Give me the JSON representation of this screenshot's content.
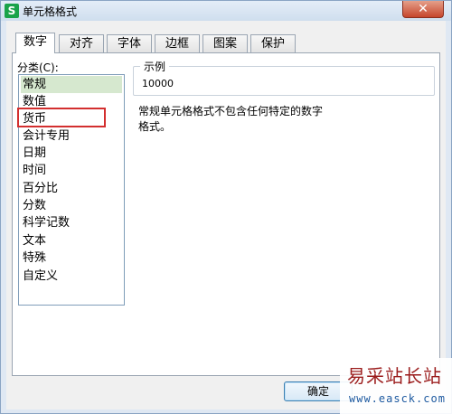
{
  "window": {
    "title": "单元格格式",
    "app_icon_letter": "S",
    "close_glyph": "✕"
  },
  "tabs": [
    {
      "label": "数字"
    },
    {
      "label": "对齐"
    },
    {
      "label": "字体"
    },
    {
      "label": "边框"
    },
    {
      "label": "图案"
    },
    {
      "label": "保护"
    }
  ],
  "category": {
    "label": "分类(C):",
    "items": [
      "常规",
      "数值",
      "货币",
      "会计专用",
      "日期",
      "时间",
      "百分比",
      "分数",
      "科学记数",
      "文本",
      "特殊",
      "自定义"
    ],
    "selected": "常规"
  },
  "sample": {
    "legend": "示例",
    "value": "10000"
  },
  "description": {
    "line1": "常规单元格格式不包含任何特定的数字",
    "line2": "格式。"
  },
  "buttons": {
    "ok": "确定"
  },
  "watermark": {
    "title": "易采站长站",
    "url": "www.easck.com"
  },
  "colors": {
    "selection": "#d6e8cf",
    "highlight": "#d32f2f",
    "app_icon": "#1aa34a"
  }
}
